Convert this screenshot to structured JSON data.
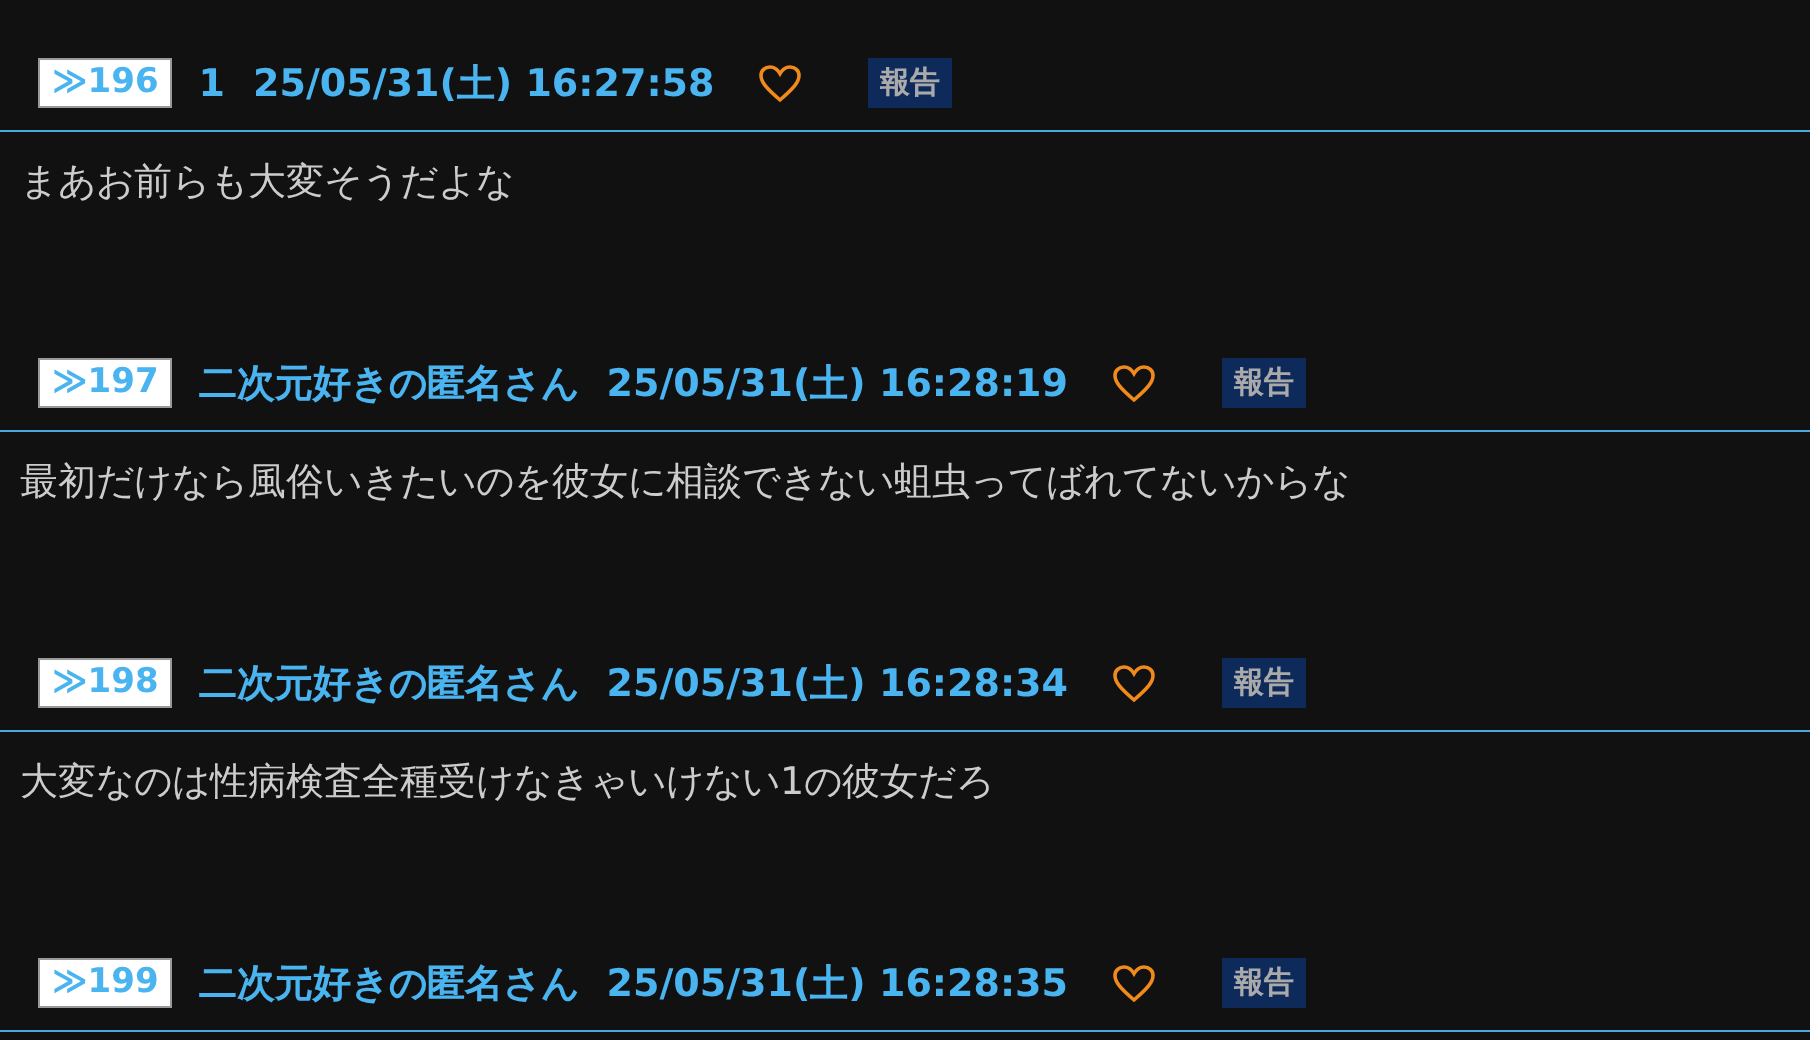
{
  "posts": [
    {
      "number": "≫196",
      "name": "1",
      "date": "25/05/31(土) 16:27:58",
      "report": "報告",
      "body": "まあお前らも大変そうだよな"
    },
    {
      "number": "≫197",
      "name": "二次元好きの匿名さん",
      "date": "25/05/31(土) 16:28:19",
      "report": "報告",
      "body": "最初だけなら風俗いきたいのを彼女に相談できない蛆虫ってばれてないからな"
    },
    {
      "number": "≫198",
      "name": "二次元好きの匿名さん",
      "date": "25/05/31(土) 16:28:34",
      "report": "報告",
      "body": "大変なのは性病検査全種受けなきゃいけない1の彼女だろ"
    },
    {
      "number": "≫199",
      "name": "二次元好きの匿名さん",
      "date": "25/05/31(土) 16:28:35",
      "report": "報告"
    }
  ]
}
